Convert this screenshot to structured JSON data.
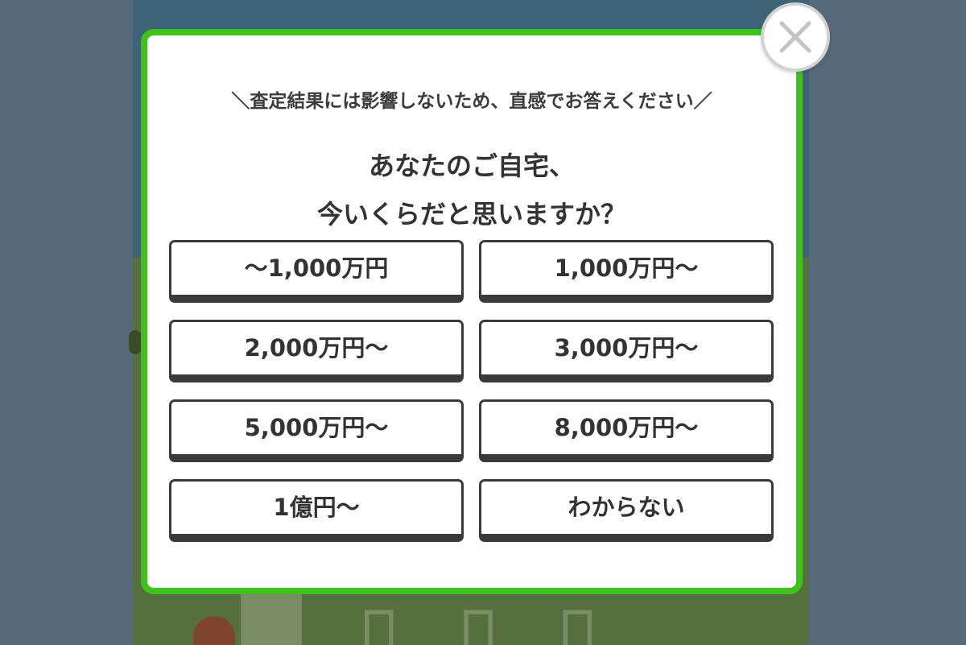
{
  "modal": {
    "subtitle": "＼査定結果には影響しないため、直感でお答えください／",
    "question_line1": "あなたのご自宅、",
    "question_line2": "今いくらだと思いますか？",
    "answers": [
      "〜1,000万円",
      "1,000万円〜",
      "2,000万円〜",
      "3,000万円〜",
      "5,000万円〜",
      "8,000万円〜",
      "1億円〜",
      "わからない"
    ]
  },
  "icons": {
    "close": "close-icon"
  },
  "colors": {
    "modal_border": "#3fc11e",
    "button_border": "#3a3a3a",
    "text": "#333333",
    "overlay": "#56697a"
  }
}
